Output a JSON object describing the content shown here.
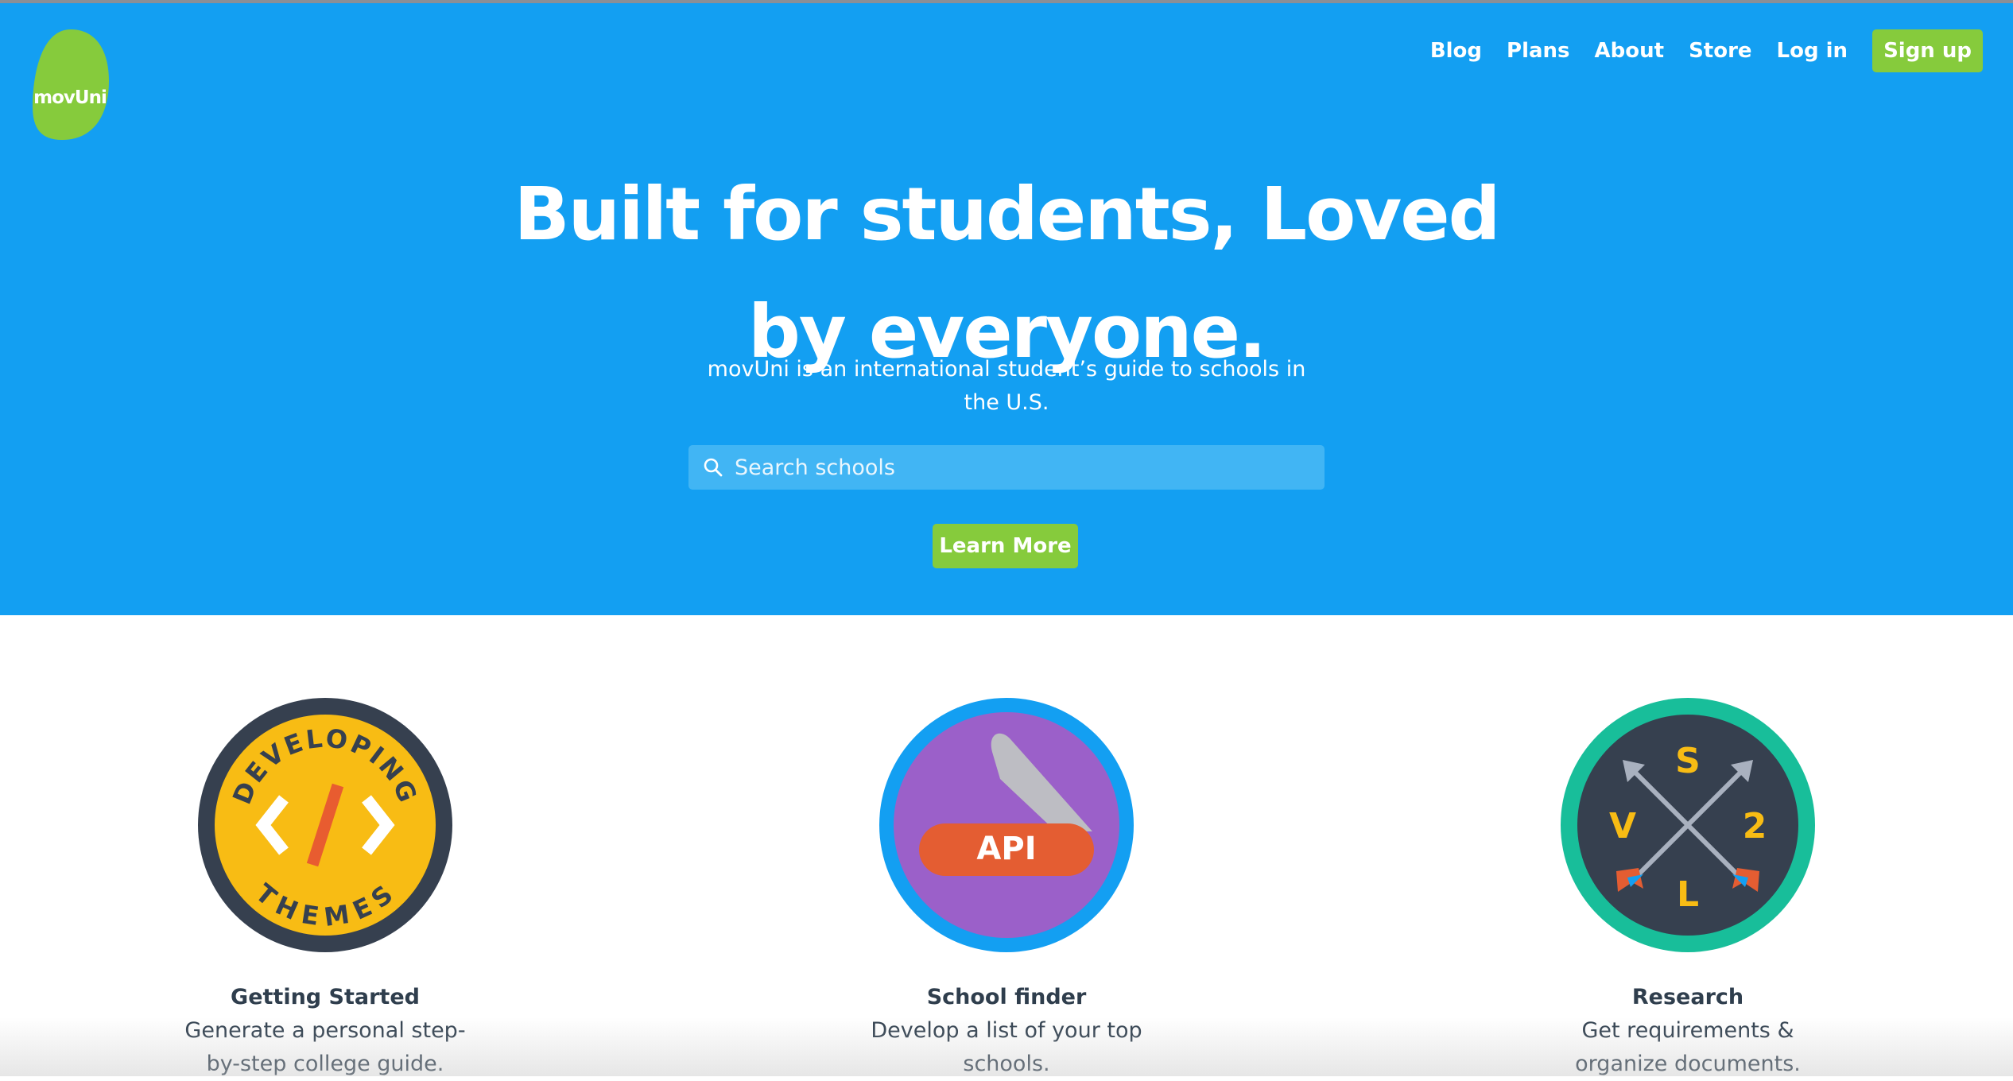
{
  "brand": {
    "logo_text": "movUni",
    "logo_color": "#86cb3c"
  },
  "colors": {
    "hero_bg": "#139ff2",
    "accent_green": "#86cb3c",
    "text_dark": "#2f3e4d"
  },
  "nav": {
    "items": [
      {
        "label": "Blog"
      },
      {
        "label": "Plans"
      },
      {
        "label": "About"
      },
      {
        "label": "Store"
      },
      {
        "label": "Log in"
      }
    ],
    "signup_label": "Sign up"
  },
  "hero": {
    "title_line1": "Built for students, Loved",
    "title_line2": "by everyone.",
    "subtitle_line1": "movUni is an international student’s guide to schools in",
    "subtitle_line2": "the U.S.",
    "search_placeholder": "Search schools",
    "search_icon": "search-icon",
    "cta_label": "Learn More"
  },
  "features": [
    {
      "title": "Getting Started",
      "desc_line1": "Generate a personal step-",
      "desc_line2": "by-step college guide.",
      "badge": {
        "top_text": "DEVELOPING",
        "bottom_text": "THEMES",
        "center": "</>"
      }
    },
    {
      "title": "School finder",
      "desc_line1": "Develop a list of your top",
      "desc_line2": "schools.",
      "badge": {
        "label": "API"
      }
    },
    {
      "title": "Research",
      "desc_line1": "Get requirements &",
      "desc_line2": "organize documents.",
      "badge": {
        "top": "S",
        "left": "V",
        "right": "2",
        "bottom": "L"
      }
    }
  ]
}
